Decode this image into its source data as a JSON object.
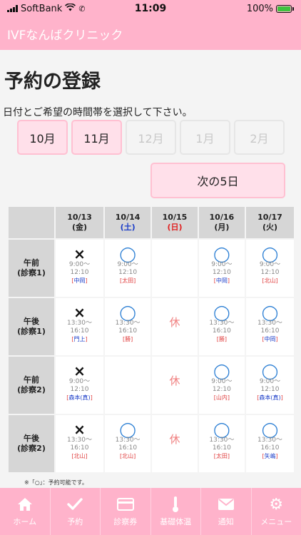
{
  "status_bar": {
    "carrier": "SoftBank",
    "time": "11:09",
    "battery": "100%"
  },
  "app_bar": {
    "title": "IVFなんばクリニック"
  },
  "page": {
    "title": "予約の登録",
    "instruction": "日付とご希望の時間帯を選択して下さい。"
  },
  "months": [
    {
      "label": "10月",
      "state": "active"
    },
    {
      "label": "11月",
      "state": "active"
    },
    {
      "label": "12月",
      "state": "disabled"
    },
    {
      "label": "1月",
      "state": "disabled"
    },
    {
      "label": "2月",
      "state": "disabled"
    }
  ],
  "next_button": {
    "label": "次の5日"
  },
  "schedule": {
    "days": [
      {
        "date": "10/13",
        "weekday": "(金)",
        "weekday_color": "normal"
      },
      {
        "date": "10/14",
        "weekday": "(土)",
        "weekday_color": "saturday"
      },
      {
        "date": "10/15",
        "weekday": "(日)",
        "weekday_color": "sunday"
      },
      {
        "date": "10/16",
        "weekday": "(月)",
        "weekday_color": "normal"
      },
      {
        "date": "10/17",
        "weekday": "(火)",
        "weekday_color": "normal"
      }
    ],
    "rows": [
      {
        "period": "午前",
        "room": "(診察1)",
        "cells": [
          {
            "mark": "×",
            "time1": "9:00～",
            "time2": "12:10",
            "doctor": "中岡",
            "doctor_color": "blue"
          },
          {
            "mark": "◯",
            "time1": "9:00～",
            "time2": "12:10",
            "doctor": "太田",
            "doctor_color": "red"
          },
          {
            "mark": "",
            "time1": "",
            "time2": "",
            "doctor": "",
            "doctor_color": ""
          },
          {
            "mark": "◯",
            "time1": "9:00～",
            "time2": "12:10",
            "doctor": "中岡",
            "doctor_color": "blue"
          },
          {
            "mark": "◯",
            "time1": "9:00～",
            "time2": "12:10",
            "doctor": "北山",
            "doctor_color": "red"
          }
        ]
      },
      {
        "period": "午後",
        "room": "(診察1)",
        "cells": [
          {
            "mark": "×",
            "time1": "13:30～",
            "time2": "16:10",
            "doctor": "門上",
            "doctor_color": "blue"
          },
          {
            "mark": "◯",
            "time1": "13:30～",
            "time2": "16:10",
            "doctor": "勝",
            "doctor_color": "red"
          },
          {
            "mark": "休",
            "time1": "",
            "time2": "",
            "doctor": "",
            "doctor_color": ""
          },
          {
            "mark": "◯",
            "time1": "13:30～",
            "time2": "16:10",
            "doctor": "勝",
            "doctor_color": "red"
          },
          {
            "mark": "◯",
            "time1": "13:30～",
            "time2": "16:10",
            "doctor": "中岡",
            "doctor_color": "blue"
          }
        ]
      },
      {
        "period": "午前",
        "room": "(診察2)",
        "cells": [
          {
            "mark": "×",
            "time1": "9:00～",
            "time2": "12:10",
            "doctor": "森本(真)",
            "doctor_color": "blue"
          },
          {
            "mark": "",
            "time1": "",
            "time2": "",
            "doctor": "",
            "doctor_color": ""
          },
          {
            "mark": "休",
            "time1": "",
            "time2": "",
            "doctor": "",
            "doctor_color": ""
          },
          {
            "mark": "◯",
            "time1": "9:00～",
            "time2": "12:10",
            "doctor": "山内",
            "doctor_color": "red"
          },
          {
            "mark": "◯",
            "time1": "9:00～",
            "time2": "12:10",
            "doctor": "森本(真)",
            "doctor_color": "blue"
          }
        ]
      },
      {
        "period": "午後",
        "room": "(診察2)",
        "cells": [
          {
            "mark": "×",
            "time1": "13:30～",
            "time2": "16:10",
            "doctor": "北山",
            "doctor_color": "red"
          },
          {
            "mark": "◯",
            "time1": "13:30～",
            "time2": "16:10",
            "doctor": "北山",
            "doctor_color": "red"
          },
          {
            "mark": "休",
            "time1": "",
            "time2": "",
            "doctor": "",
            "doctor_color": ""
          },
          {
            "mark": "◯",
            "time1": "13:30～",
            "time2": "16:10",
            "doctor": "太田",
            "doctor_color": "red"
          },
          {
            "mark": "◯",
            "time1": "13:30～",
            "time2": "16:10",
            "doctor": "矢嶋",
            "doctor_color": "blue"
          }
        ]
      }
    ]
  },
  "note": "※「○」：予約可能です。",
  "tabs": [
    {
      "label": "ホーム",
      "icon": "home-icon"
    },
    {
      "label": "予約",
      "icon": "check-icon"
    },
    {
      "label": "診察券",
      "icon": "card-icon"
    },
    {
      "label": "基礎体温",
      "icon": "thermometer-icon"
    },
    {
      "label": "通知",
      "icon": "mail-icon"
    },
    {
      "label": "メニュー",
      "icon": "gear-icon"
    }
  ],
  "colors": {
    "brand_pink": "#ffb3cb",
    "button_pink": "#ffe0ea",
    "available_blue": "#2c7fd4",
    "holiday_red": "#f08080"
  }
}
